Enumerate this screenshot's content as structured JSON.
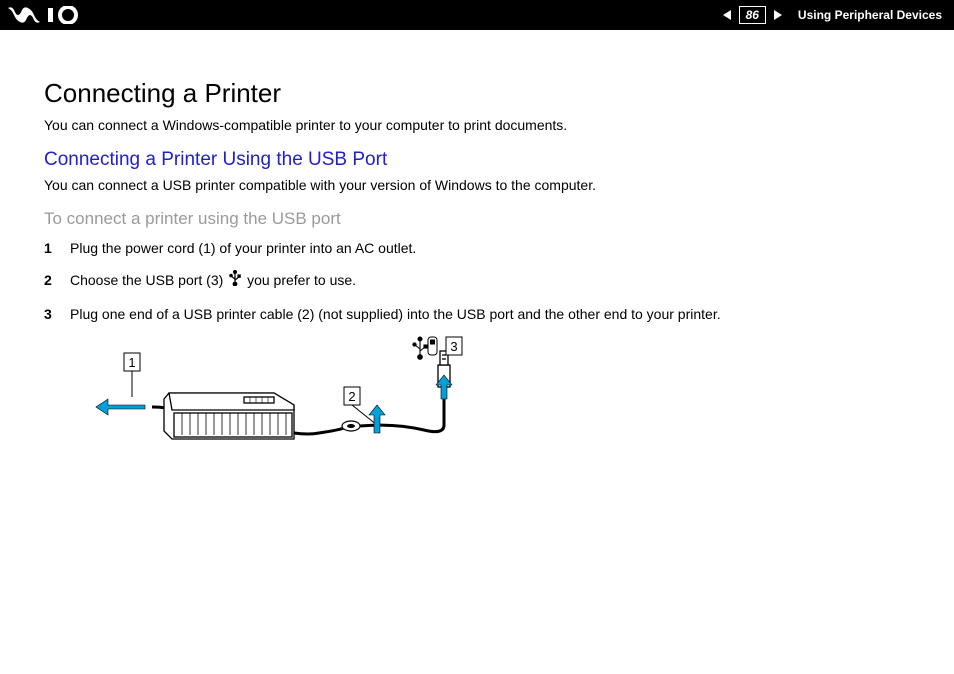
{
  "header": {
    "page_number": "86",
    "section": "Using Peripheral Devices"
  },
  "title": "Connecting a Printer",
  "intro": "You can connect a Windows-compatible printer to your computer to print documents.",
  "subheading_blue": "Connecting a Printer Using the USB Port",
  "sub_intro": "You can connect a USB printer compatible with your version of Windows to the computer.",
  "subheading_gray": "To connect a printer using the USB port",
  "steps": {
    "s1": "Plug the power cord (1) of your printer into an AC outlet.",
    "s2a": "Choose the USB port (3) ",
    "s2b": " you prefer to use.",
    "s3": "Plug one end of a USB printer cable (2) (not supplied) into the USB port and the other end to your printer."
  },
  "diagram_labels": {
    "l1": "1",
    "l2": "2",
    "l3": "3"
  }
}
